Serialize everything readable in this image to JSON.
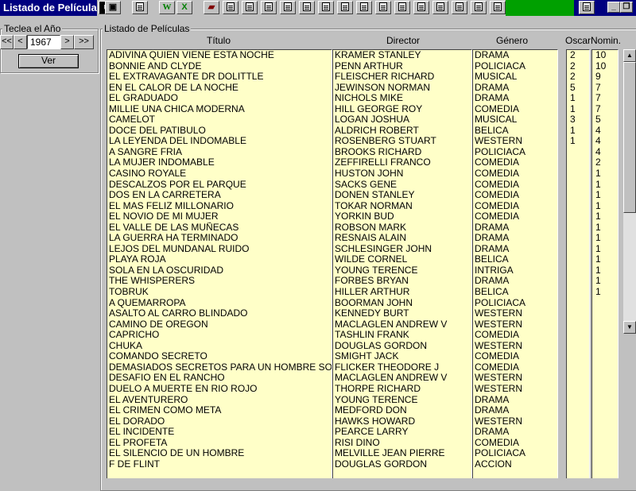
{
  "window": {
    "title": "Listado de Películas"
  },
  "toolbar": {
    "buttons": [
      "",
      "",
      "W",
      "X",
      "",
      "",
      "",
      "",
      "",
      "",
      "",
      "",
      "",
      "",
      "",
      "",
      ""
    ],
    "icon_names": [
      "save-icon",
      "print-icon",
      "word-icon",
      "excel-icon",
      "book-icon",
      "report-icon"
    ]
  },
  "year_panel": {
    "title": "Teclea el Año",
    "first_label": "<<",
    "prev_label": "<",
    "year_value": "1967",
    "next_label": ">",
    "last_label": ">>",
    "ver_label": "Ver"
  },
  "list": {
    "group_title": "Listado de Películas",
    "headers": {
      "titulo": "Título",
      "director": "Director",
      "genero": "Género",
      "oscar": "Oscar",
      "nomin": "Nomin."
    },
    "rows": [
      {
        "titulo": "ADIVINA QUIEN VIENE ESTA NOCHE",
        "director": "KRAMER STANLEY",
        "genero": "DRAMA",
        "oscar": "2",
        "nomin": "10"
      },
      {
        "titulo": "BONNIE AND CLYDE",
        "director": "PENN ARTHUR",
        "genero": "POLICIACA",
        "oscar": "2",
        "nomin": "10"
      },
      {
        "titulo": "EL EXTRAVAGANTE DR DOLITTLE",
        "director": "FLEISCHER RICHARD",
        "genero": "MUSICAL",
        "oscar": "2",
        "nomin": "9"
      },
      {
        "titulo": "EN EL CALOR DE LA NOCHE",
        "director": "JEWINSON NORMAN",
        "genero": "DRAMA",
        "oscar": "5",
        "nomin": "7"
      },
      {
        "titulo": "EL GRADUADO",
        "director": "NICHOLS MIKE",
        "genero": "DRAMA",
        "oscar": "1",
        "nomin": "7"
      },
      {
        "titulo": "MILLIE UNA CHICA MODERNA",
        "director": "HILL GEORGE ROY",
        "genero": "COMEDIA",
        "oscar": "1",
        "nomin": "7"
      },
      {
        "titulo": "CAMELOT",
        "director": "LOGAN JOSHUA",
        "genero": "MUSICAL",
        "oscar": "3",
        "nomin": "5"
      },
      {
        "titulo": "DOCE DEL PATIBULO",
        "director": "ALDRICH ROBERT",
        "genero": "BELICA",
        "oscar": "1",
        "nomin": "4"
      },
      {
        "titulo": "LA LEYENDA DEL INDOMABLE",
        "director": "ROSENBERG STUART",
        "genero": "WESTERN",
        "oscar": "1",
        "nomin": "4"
      },
      {
        "titulo": "A SANGRE FRIA",
        "director": "BROOKS RICHARD",
        "genero": "POLICIACA",
        "oscar": "",
        "nomin": "4"
      },
      {
        "titulo": "LA MUJER INDOMABLE",
        "director": "ZEFFIRELLI FRANCO",
        "genero": "COMEDIA",
        "oscar": "",
        "nomin": "2"
      },
      {
        "titulo": "CASINO ROYALE",
        "director": "HUSTON JOHN",
        "genero": "COMEDIA",
        "oscar": "",
        "nomin": "1"
      },
      {
        "titulo": "DESCALZOS POR EL PARQUE",
        "director": "SACKS GENE",
        "genero": "COMEDIA",
        "oscar": "",
        "nomin": "1"
      },
      {
        "titulo": "DOS EN LA CARRETERA",
        "director": "DONEN STANLEY",
        "genero": "COMEDIA",
        "oscar": "",
        "nomin": "1"
      },
      {
        "titulo": "EL MAS FELIZ MILLONARIO",
        "director": "TOKAR NORMAN",
        "genero": "COMEDIA",
        "oscar": "",
        "nomin": "1"
      },
      {
        "titulo": "EL NOVIO DE MI MUJER",
        "director": "YORKIN BUD",
        "genero": "COMEDIA",
        "oscar": "",
        "nomin": "1"
      },
      {
        "titulo": "EL VALLE DE LAS MUÑECAS",
        "director": "ROBSON MARK",
        "genero": "DRAMA",
        "oscar": "",
        "nomin": "1"
      },
      {
        "titulo": "LA GUERRA HA TERMINADO",
        "director": "RESNAIS ALAIN",
        "genero": "DRAMA",
        "oscar": "",
        "nomin": "1"
      },
      {
        "titulo": "LEJOS DEL MUNDANAL RUIDO",
        "director": "SCHLESINGER JOHN",
        "genero": "DRAMA",
        "oscar": "",
        "nomin": "1"
      },
      {
        "titulo": "PLAYA ROJA",
        "director": "WILDE CORNEL",
        "genero": "BELICA",
        "oscar": "",
        "nomin": "1"
      },
      {
        "titulo": "SOLA EN LA OSCURIDAD",
        "director": "YOUNG TERENCE",
        "genero": "INTRIGA",
        "oscar": "",
        "nomin": "1"
      },
      {
        "titulo": "THE WHISPERERS",
        "director": "FORBES BRYAN",
        "genero": "DRAMA",
        "oscar": "",
        "nomin": "1"
      },
      {
        "titulo": "TOBRUK",
        "director": "HILLER ARTHUR",
        "genero": "BELICA",
        "oscar": "",
        "nomin": "1"
      },
      {
        "titulo": "A QUEMARROPA",
        "director": "BOORMAN JOHN",
        "genero": "POLICIACA",
        "oscar": "",
        "nomin": ""
      },
      {
        "titulo": "ASALTO AL CARRO BLINDADO",
        "director": "KENNEDY BURT",
        "genero": "WESTERN",
        "oscar": "",
        "nomin": ""
      },
      {
        "titulo": "CAMINO DE OREGON",
        "director": "MACLAGLEN ANDREW V",
        "genero": "WESTERN",
        "oscar": "",
        "nomin": ""
      },
      {
        "titulo": "CAPRICHO",
        "director": "TASHLIN FRANK",
        "genero": "COMEDIA",
        "oscar": "",
        "nomin": ""
      },
      {
        "titulo": "CHUKA",
        "director": "DOUGLAS GORDON",
        "genero": "WESTERN",
        "oscar": "",
        "nomin": ""
      },
      {
        "titulo": "COMANDO SECRETO",
        "director": "SMIGHT JACK",
        "genero": "COMEDIA",
        "oscar": "",
        "nomin": ""
      },
      {
        "titulo": "DEMASIADOS SECRETOS PARA UN HOMBRE SOLO",
        "director": "FLICKER THEODORE J",
        "genero": "COMEDIA",
        "oscar": "",
        "nomin": ""
      },
      {
        "titulo": "DESAFIO EN EL RANCHO",
        "director": "MACLAGLEN ANDREW V",
        "genero": "WESTERN",
        "oscar": "",
        "nomin": ""
      },
      {
        "titulo": "DUELO A MUERTE EN RIO ROJO",
        "director": "THORPE RICHARD",
        "genero": "WESTERN",
        "oscar": "",
        "nomin": ""
      },
      {
        "titulo": "EL AVENTURERO",
        "director": "YOUNG TERENCE",
        "genero": "DRAMA",
        "oscar": "",
        "nomin": ""
      },
      {
        "titulo": "EL CRIMEN COMO META",
        "director": "MEDFORD DON",
        "genero": "DRAMA",
        "oscar": "",
        "nomin": ""
      },
      {
        "titulo": "EL DORADO",
        "director": "HAWKS HOWARD",
        "genero": "WESTERN",
        "oscar": "",
        "nomin": ""
      },
      {
        "titulo": "EL INCIDENTE",
        "director": "PEARCE LARRY",
        "genero": "DRAMA",
        "oscar": "",
        "nomin": ""
      },
      {
        "titulo": "EL PROFETA",
        "director": "RISI DINO",
        "genero": "COMEDIA",
        "oscar": "",
        "nomin": ""
      },
      {
        "titulo": "EL SILENCIO DE UN HOMBRE",
        "director": "MELVILLE JEAN PIERRE",
        "genero": "POLICIACA",
        "oscar": "",
        "nomin": ""
      },
      {
        "titulo": "F DE FLINT",
        "director": "DOUGLAS GORDON",
        "genero": "ACCION",
        "oscar": "",
        "nomin": ""
      }
    ]
  },
  "scrollbar": {
    "up_label": "▲",
    "down_label": "▼"
  },
  "colors": {
    "title_bg": "#000080",
    "list_bg": "#ffffc8",
    "face": "#c0c0c0",
    "green": "#00a000"
  }
}
